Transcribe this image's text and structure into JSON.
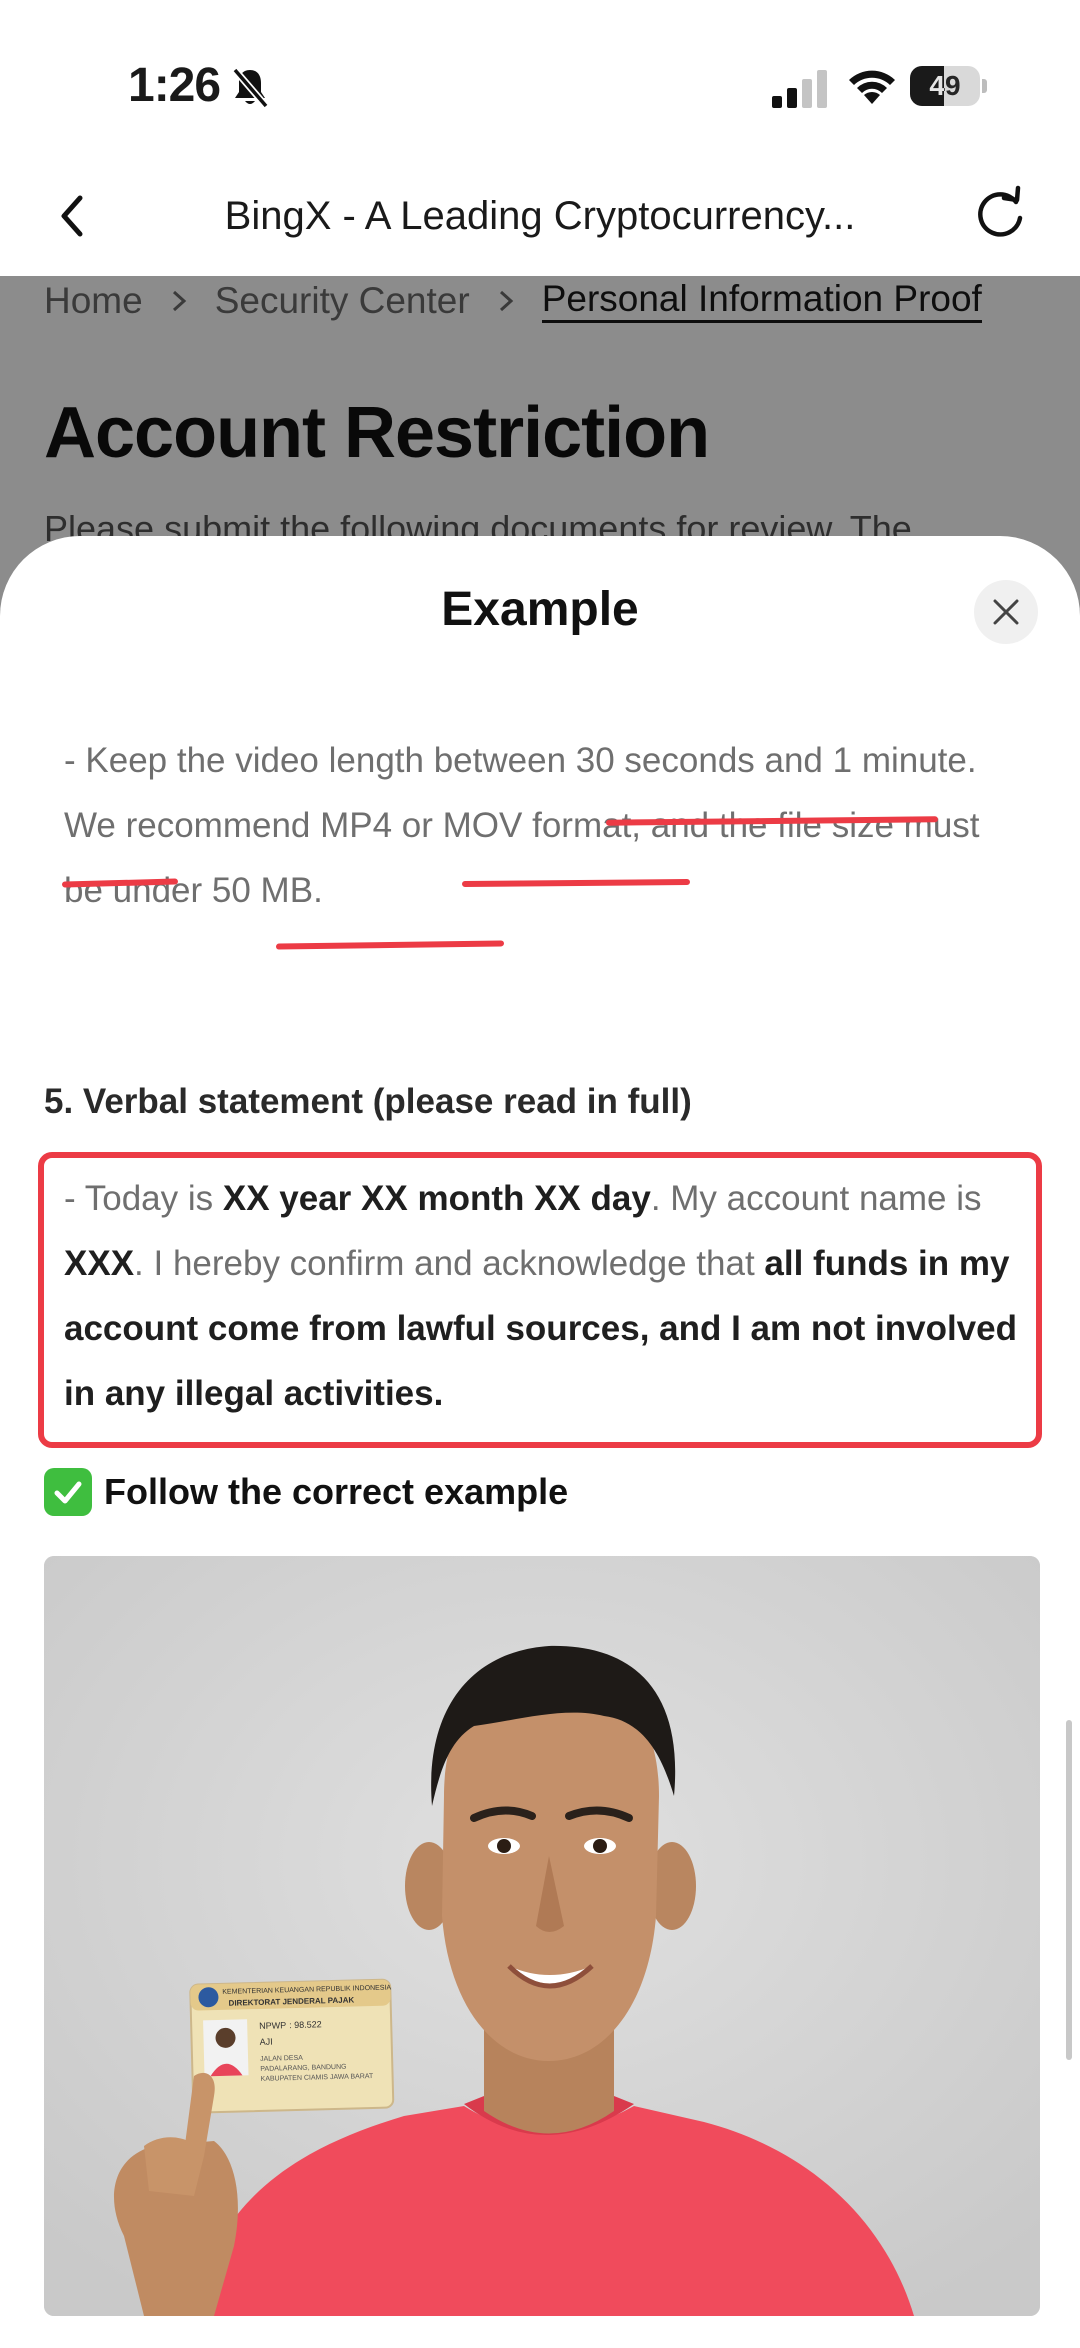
{
  "status_bar": {
    "time": "1:26",
    "battery": "49",
    "battery_level": 0.49
  },
  "nav": {
    "title": "BingX - A Leading Cryptocurrency..."
  },
  "background_page": {
    "breadcrumb": [
      "Home",
      "Security Center",
      "Personal Information Proof"
    ],
    "heading": "Account Restriction",
    "description": "Please submit the following documents for review. The"
  },
  "sheet": {
    "title": "Example",
    "video_rule": {
      "p1": "- Keep the video length between ",
      "u1": "30 seconds and 1 minute",
      "p2": ". We recommend ",
      "u2": "MP4 or MOV",
      "p3": " format, and the file size must be ",
      "u3": "under 50 MB",
      "p4": "."
    },
    "section5_heading": "5. Verbal statement (please read in full)",
    "statement": {
      "p1": "- Today is ",
      "b1": "XX year XX month XX day",
      "p2": ". My account name is ",
      "b2": "XXX",
      "p3": ". I hereby confirm and acknowledge that ",
      "b3": "all funds in my account come from lawful sources, and I am not involved in any illegal activities."
    },
    "correct_example_label": "Follow the correct example",
    "id_card": {
      "header_line1": "KEMENTERIAN KEUANGAN REPUBLIK INDONESIA",
      "header_line2": "DIREKTORAT JENDERAL PAJAK",
      "npwp_label": "NPWP",
      "npwp_value": ": 98.522",
      "name": "AJI",
      "line1": "JALAN DESA",
      "line2": "PADALARANG, BANDUNG",
      "line3": "KABUPATEN CIAMIS JAWA BARAT"
    }
  },
  "colors": {
    "accent_red": "#ec3b45",
    "check_green": "#3fbe3f",
    "shirt": "#f04b5c"
  }
}
